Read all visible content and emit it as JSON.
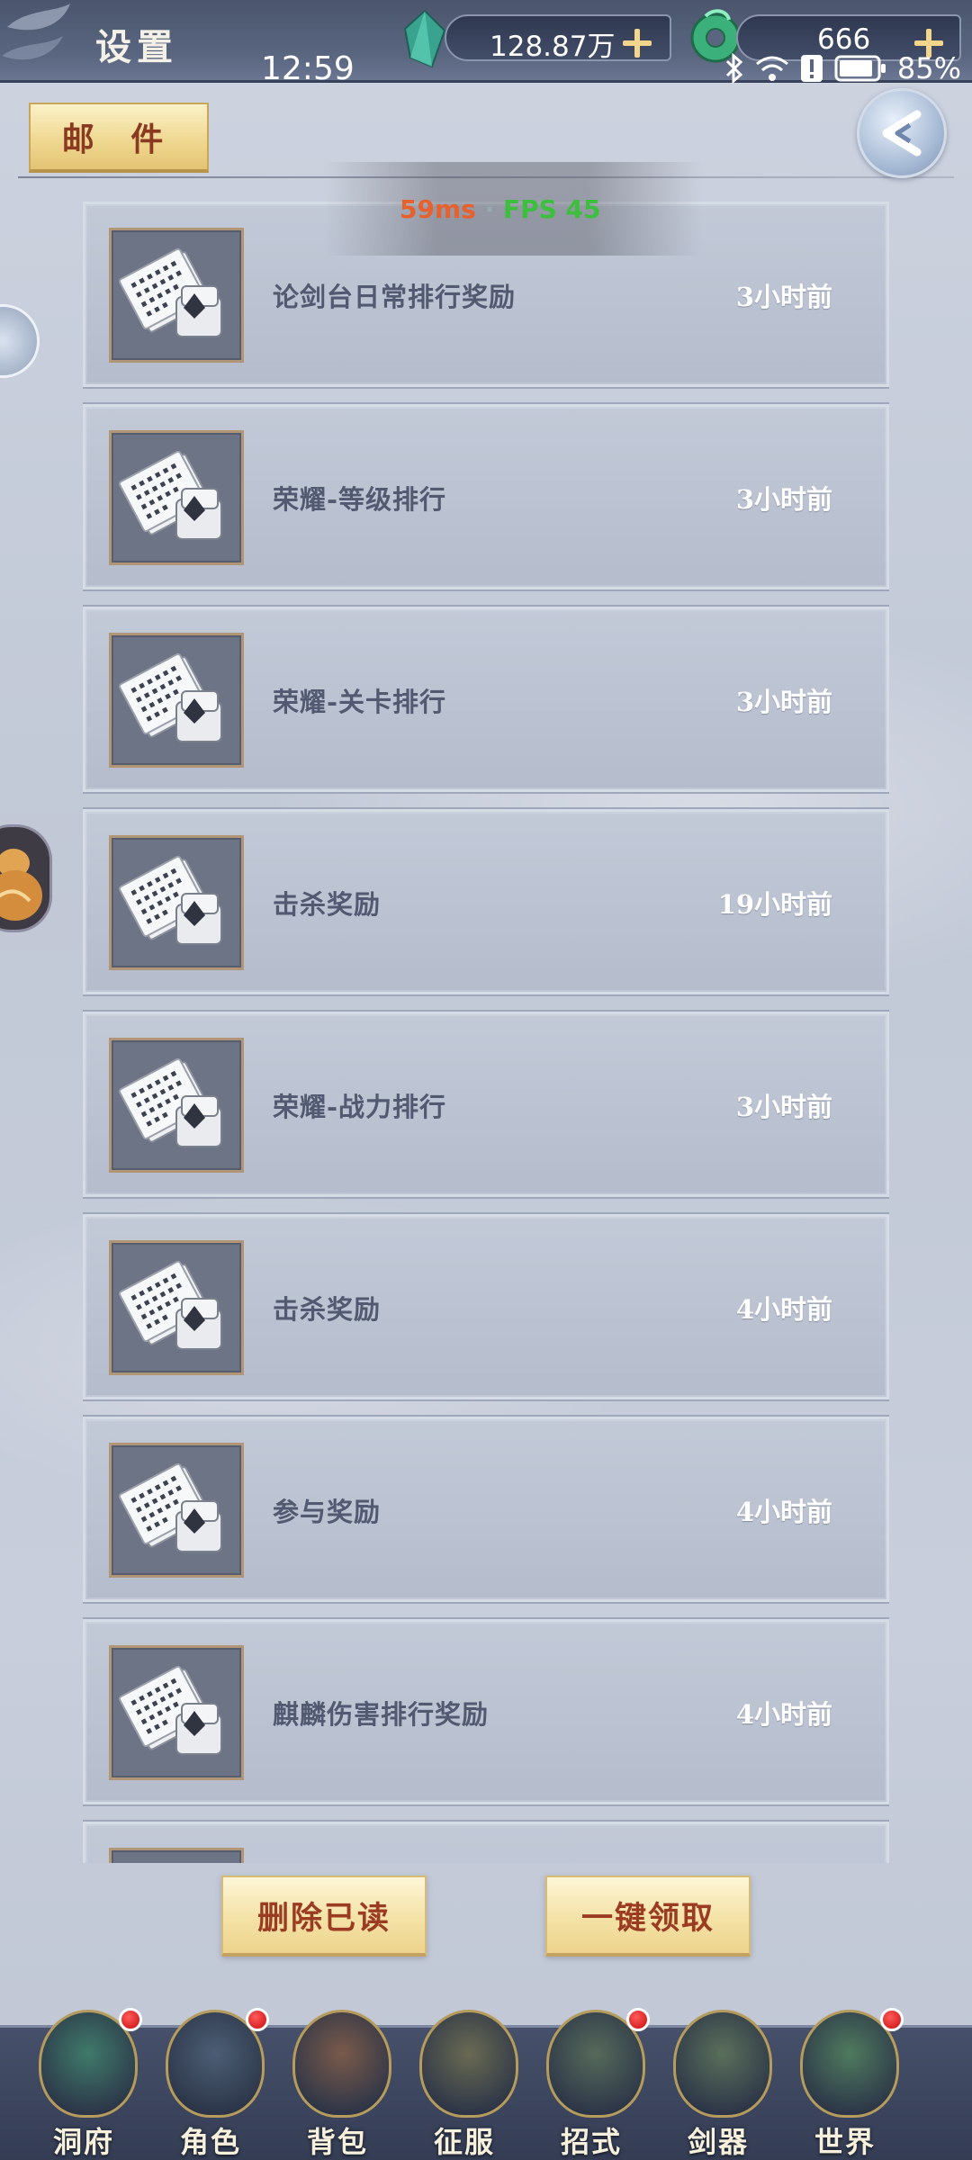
{
  "status_bar": {
    "time": "12:59",
    "battery_percent": "85%"
  },
  "top_bar": {
    "title": "设置",
    "currency_1": {
      "value": "128.87万",
      "icon": "crystal-icon"
    },
    "currency_2": {
      "value": "666",
      "icon": "jade-icon"
    }
  },
  "header": {
    "tab_label": "邮 件",
    "back_icon": "back-arrow-icon"
  },
  "perf": {
    "ping": "59ms",
    "separator": "·",
    "fps": "FPS 45"
  },
  "mails": [
    {
      "title": "论剑台日常排行奖励",
      "time": "3小时前",
      "icon": "mail-scroll-icon"
    },
    {
      "title": "荣耀-等级排行",
      "time": "3小时前",
      "icon": "mail-scroll-icon"
    },
    {
      "title": "荣耀-关卡排行",
      "time": "3小时前",
      "icon": "mail-scroll-icon"
    },
    {
      "title": "击杀奖励",
      "time": "19小时前",
      "icon": "mail-scroll-icon"
    },
    {
      "title": "荣耀-战力排行",
      "time": "3小时前",
      "icon": "mail-scroll-icon"
    },
    {
      "title": "击杀奖励",
      "time": "4小时前",
      "icon": "mail-scroll-icon"
    },
    {
      "title": "参与奖励",
      "time": "4小时前",
      "icon": "mail-scroll-icon"
    },
    {
      "title": "麒麟伤害排行奖励",
      "time": "4小时前",
      "icon": "mail-scroll-icon"
    },
    {
      "title": "",
      "time": "",
      "icon": "mail-scroll-icon"
    }
  ],
  "actions": {
    "delete_read": "删除已读",
    "claim_all": "一键领取"
  },
  "bottom_nav": [
    {
      "label": "洞府",
      "badge": true
    },
    {
      "label": "角色",
      "badge": true
    },
    {
      "label": "背包",
      "badge": false
    },
    {
      "label": "征服",
      "badge": false
    },
    {
      "label": "招式",
      "badge": true
    },
    {
      "label": "剑器",
      "badge": false
    },
    {
      "label": "世界",
      "badge": true
    }
  ],
  "colors": {
    "accent_gold": "#efd891",
    "button_text": "#9b3b22",
    "badge_red": "#c80d0d"
  }
}
